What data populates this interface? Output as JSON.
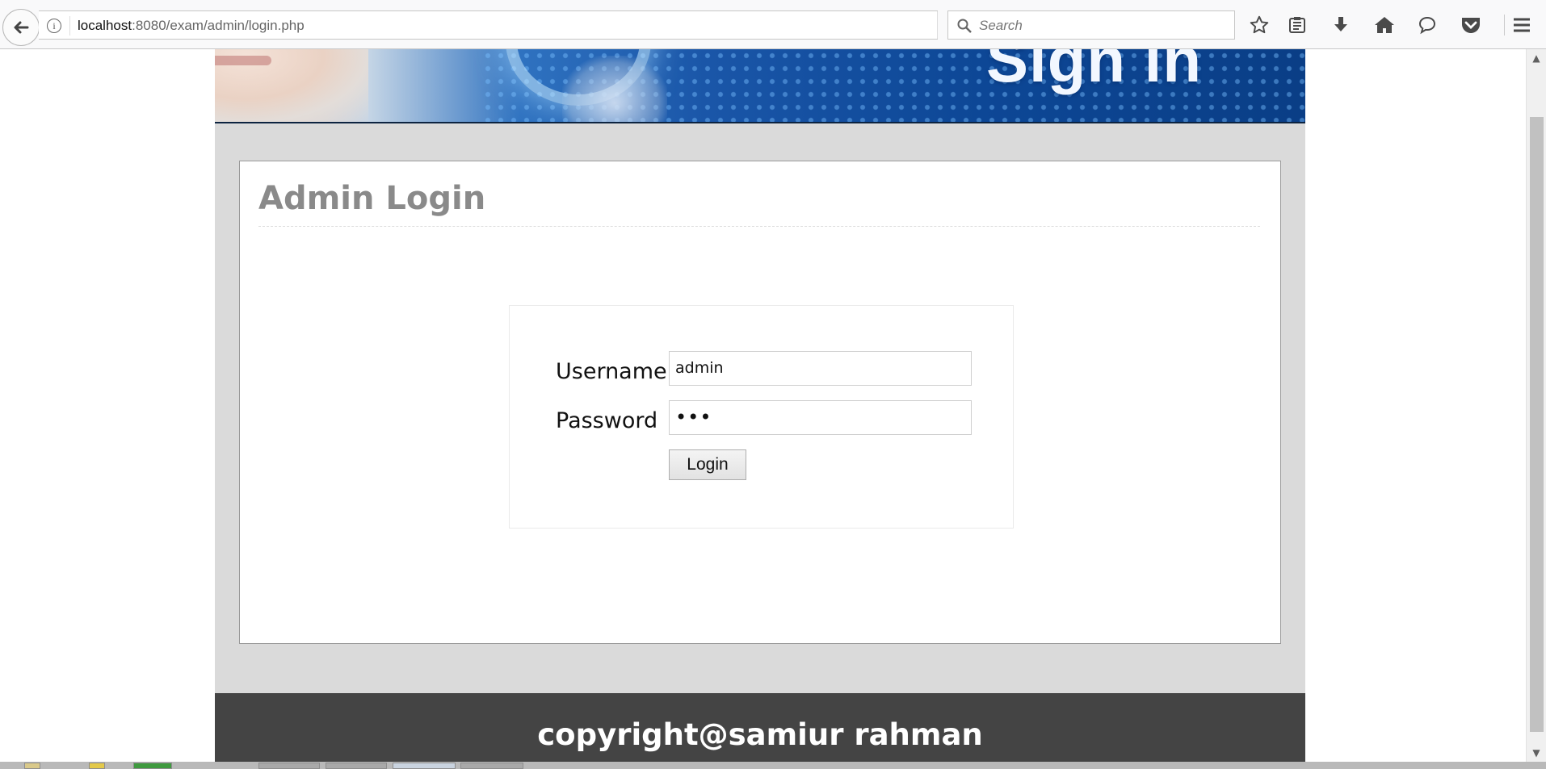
{
  "browser": {
    "url_host": "localhost",
    "url_rest": ":8080/exam/admin/login.php",
    "search_placeholder": "Search"
  },
  "banner": {
    "title": "Sign in"
  },
  "panel": {
    "title": "Admin Login"
  },
  "form": {
    "username_label": "Username",
    "username_value": "admin",
    "password_label": "Password",
    "password_value": "•••",
    "login_label": "Login"
  },
  "footer": {
    "text": "copyright@samiur rahman"
  },
  "colors": {
    "footer_bg": "#444444",
    "page_bg": "#dadada",
    "title_color": "#8a8a8a"
  },
  "icons": [
    "back-arrow-icon",
    "info-icon",
    "reload-icon",
    "search-icon",
    "bookmark-star-icon",
    "reading-list-icon",
    "download-icon",
    "home-icon",
    "chat-icon",
    "pocket-icon",
    "menu-icon"
  ]
}
